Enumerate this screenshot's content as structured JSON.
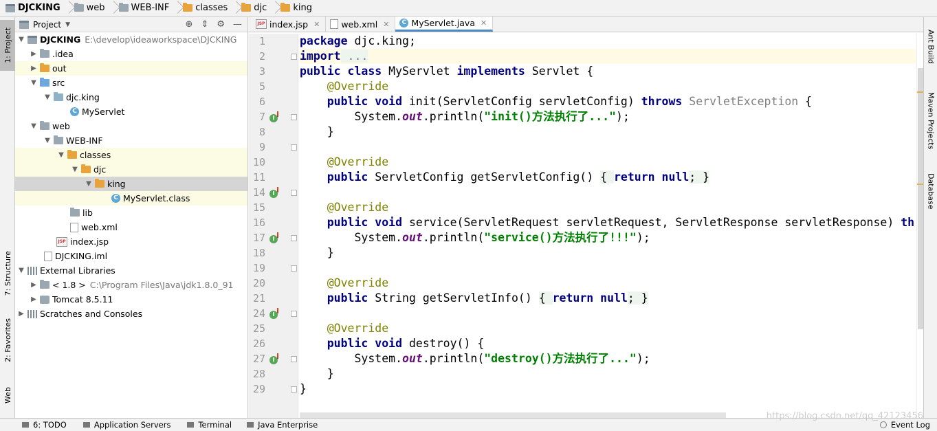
{
  "breadcrumb": [
    "DJCKING",
    "web",
    "WEB-INF",
    "classes",
    "djc",
    "king"
  ],
  "left_tools": [
    "1: Project",
    "7: Structure",
    "2: Favorites",
    "Web"
  ],
  "right_tools": [
    "Ant Build",
    "Maven Projects",
    "Database"
  ],
  "project_panel": {
    "title": "Project",
    "tree": [
      {
        "label": "DJCKING",
        "sub": "E:\\develop\\ideaworkspace\\DJCKING"
      },
      {
        "label": ".idea"
      },
      {
        "label": "out"
      },
      {
        "label": "src"
      },
      {
        "label": "djc.king"
      },
      {
        "label": "MyServlet"
      },
      {
        "label": "web"
      },
      {
        "label": "WEB-INF"
      },
      {
        "label": "classes"
      },
      {
        "label": "djc"
      },
      {
        "label": "king"
      },
      {
        "label": "MyServlet.class"
      },
      {
        "label": "lib"
      },
      {
        "label": "web.xml"
      },
      {
        "label": "index.jsp"
      },
      {
        "label": "DJCKING.iml"
      },
      {
        "label": "External Libraries"
      },
      {
        "label": "< 1.8 >",
        "sub": "C:\\Program Files\\Java\\jdk1.8.0_91"
      },
      {
        "label": "Tomcat 8.5.11"
      },
      {
        "label": "Scratches and Consoles"
      }
    ]
  },
  "editor": {
    "tabs": [
      "index.jsp",
      "web.xml",
      "MyServlet.java"
    ],
    "active_tab": "MyServlet.java",
    "line_numbers": [
      "1",
      "2",
      "3",
      "5",
      "6",
      "7",
      "8",
      "9",
      "10",
      "11",
      "14",
      "15",
      "16",
      "17",
      "18",
      "19",
      "20",
      "21",
      "24",
      "25",
      "26",
      "27",
      "28",
      "29"
    ],
    "code": {
      "l1": {
        "kw": "package",
        "rest": " djc.king;"
      },
      "l2": {
        "kw": "import",
        "rest": " ..."
      },
      "l3": {
        "k1": "public",
        "k2": "class",
        "name": " MyServlet ",
        "k3": "implements",
        "rest": " Servlet {"
      },
      "l5": {
        "ann": "@Override"
      },
      "l6": {
        "k1": "public",
        "k2": "void",
        "mid": " init(ServletConfig servletConfig) ",
        "k3": "throws",
        "exc": " ServletException",
        "rest": " {"
      },
      "l7": {
        "pre": "System.",
        "fld": "out",
        "mid": ".println(",
        "str": "\"init()方法执行了...\"",
        "rest": ");"
      },
      "l8": {
        "rest": "}"
      },
      "l10": {
        "ann": "@Override"
      },
      "l11": {
        "k1": "public",
        "mid": " ServletConfig getServletConfig() ",
        "open": "{ ",
        "k2": "return",
        "k3": " null",
        "semi": "; ",
        "close": "}"
      },
      "l15": {
        "ann": "@Override"
      },
      "l16": {
        "k1": "public",
        "k2": "void",
        "rest": " service(ServletRequest servletRequest, ServletResponse servletResponse) ",
        "k3": "thr"
      },
      "l17": {
        "pre": "System.",
        "fld": "out",
        "mid": ".println(",
        "str": "\"service()方法执行了!!!\"",
        "rest": ");"
      },
      "l18": {
        "rest": "}"
      },
      "l20": {
        "ann": "@Override"
      },
      "l21": {
        "k1": "public",
        "mid": " String getServletInfo() ",
        "open": "{ ",
        "k2": "return",
        "k3": " null",
        "semi": "; ",
        "close": "}"
      },
      "l25": {
        "ann": "@Override"
      },
      "l26": {
        "k1": "public",
        "k2": "void",
        "rest": " destroy() {"
      },
      "l27": {
        "pre": "System.",
        "fld": "out",
        "mid": ".println(",
        "str": "\"destroy()方法执行了...\"",
        "rest": ");"
      },
      "l28": {
        "rest": "}"
      },
      "l29": {
        "rest": "}"
      }
    }
  },
  "bottom_bar": {
    "items": [
      "6: TODO",
      "Application Servers",
      "Terminal",
      "Java Enterprise"
    ],
    "event_log": "Event Log"
  },
  "watermark": "https://blog.csdn.net/qq_42123456"
}
